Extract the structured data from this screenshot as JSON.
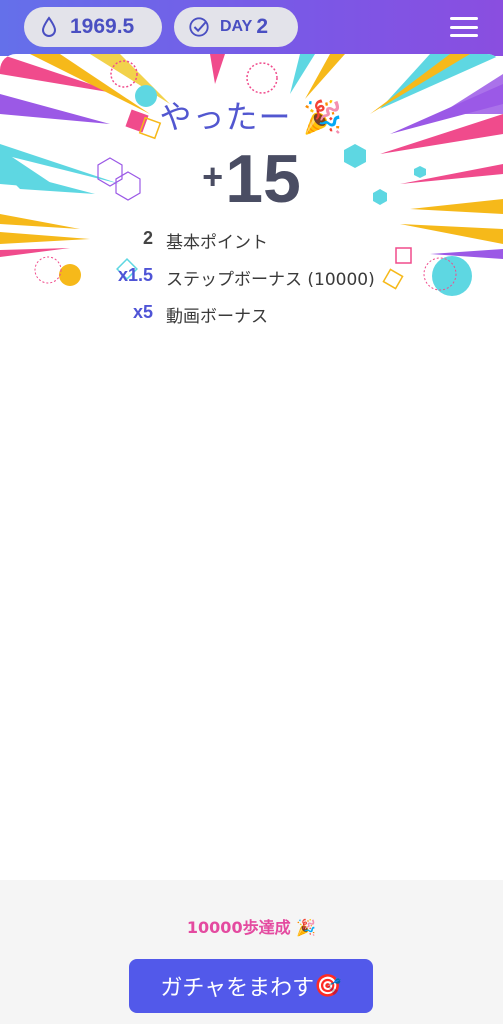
{
  "header": {
    "points": "1969.5",
    "day_label": "DAY",
    "day_number": "2",
    "accent_color": "#4a4fc2"
  },
  "result": {
    "title": "やったー",
    "title_emoji": "🎉",
    "plus_sign": "+",
    "score": "15",
    "rows": [
      {
        "multiplier": "2",
        "label": "基本ポイント",
        "color": "#444444"
      },
      {
        "multiplier": "x1.5",
        "label": "ステップボーナス (10000)",
        "color": "#4f54d6"
      },
      {
        "multiplier": "x5",
        "label": "動画ボーナス",
        "color": "#4f54d6"
      }
    ]
  },
  "footer": {
    "achievement": "10000歩達成",
    "achievement_emoji": "🎉",
    "gacha_button": "ガチャをまわす",
    "gacha_emoji": "🎯",
    "button_color": "#5259ea"
  }
}
